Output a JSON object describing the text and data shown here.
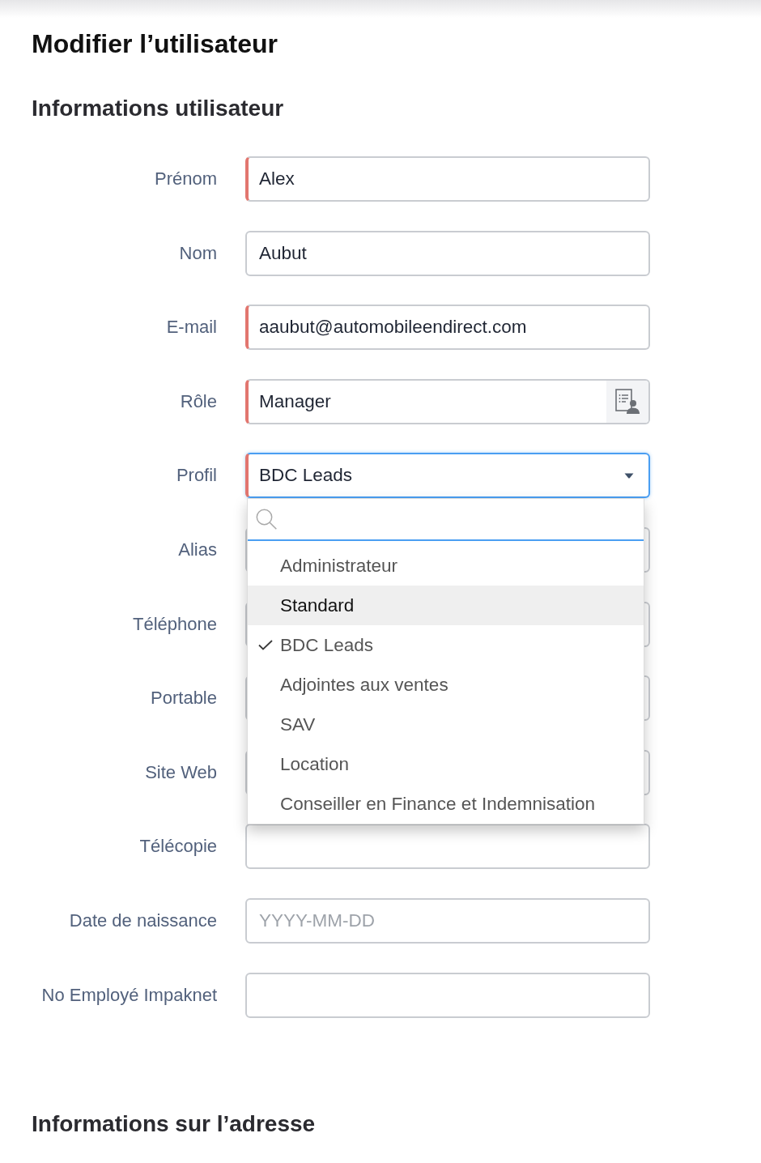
{
  "page_title": "Modifier l’utilisateur",
  "user_section": {
    "title": "Informations utilisateur",
    "fields": [
      {
        "label": "Prénom",
        "kind": "text",
        "value": "Alex",
        "required": true,
        "focused": false
      },
      {
        "label": "Nom",
        "kind": "text",
        "value": "Aubut",
        "required": false,
        "focused": false
      },
      {
        "label": "E-mail",
        "kind": "text",
        "value": "aaubut@automobileendirect.com",
        "required": true,
        "focused": false
      },
      {
        "label": "Rôle",
        "kind": "lookup",
        "value": "Manager",
        "required": true,
        "focused": false
      },
      {
        "label": "Profil",
        "kind": "select",
        "value": "BDC Leads",
        "required": true,
        "focused": true,
        "expanded": true,
        "options": [
          {
            "label": "Administrateur",
            "selected": false,
            "highlighted": false
          },
          {
            "label": "Standard",
            "selected": false,
            "highlighted": true
          },
          {
            "label": "BDC Leads",
            "selected": true,
            "highlighted": false
          },
          {
            "label": "Adjointes aux ventes",
            "selected": false,
            "highlighted": false
          },
          {
            "label": "SAV",
            "selected": false,
            "highlighted": false
          },
          {
            "label": "Location",
            "selected": false,
            "highlighted": false
          },
          {
            "label": "Conseiller en Finance et Indemnisation",
            "selected": false,
            "highlighted": false
          }
        ]
      },
      {
        "label": "Alias",
        "kind": "text",
        "required": false,
        "focused": false
      },
      {
        "label": "Téléphone",
        "kind": "text",
        "required": false,
        "focused": false
      },
      {
        "label": "Portable",
        "kind": "text",
        "required": false,
        "focused": false
      },
      {
        "label": "Site Web",
        "kind": "text",
        "required": false,
        "focused": false
      },
      {
        "label": "Télécopie",
        "kind": "text",
        "required": false,
        "focused": false
      },
      {
        "label": "Date de naissance",
        "kind": "text",
        "placeholder": "YYYY-MM-DD",
        "required": false,
        "focused": false
      },
      {
        "label": "No Employé Impaknet",
        "kind": "text",
        "required": false,
        "focused": false
      }
    ]
  },
  "address_section": {
    "title": "Informations sur l’adresse"
  }
}
